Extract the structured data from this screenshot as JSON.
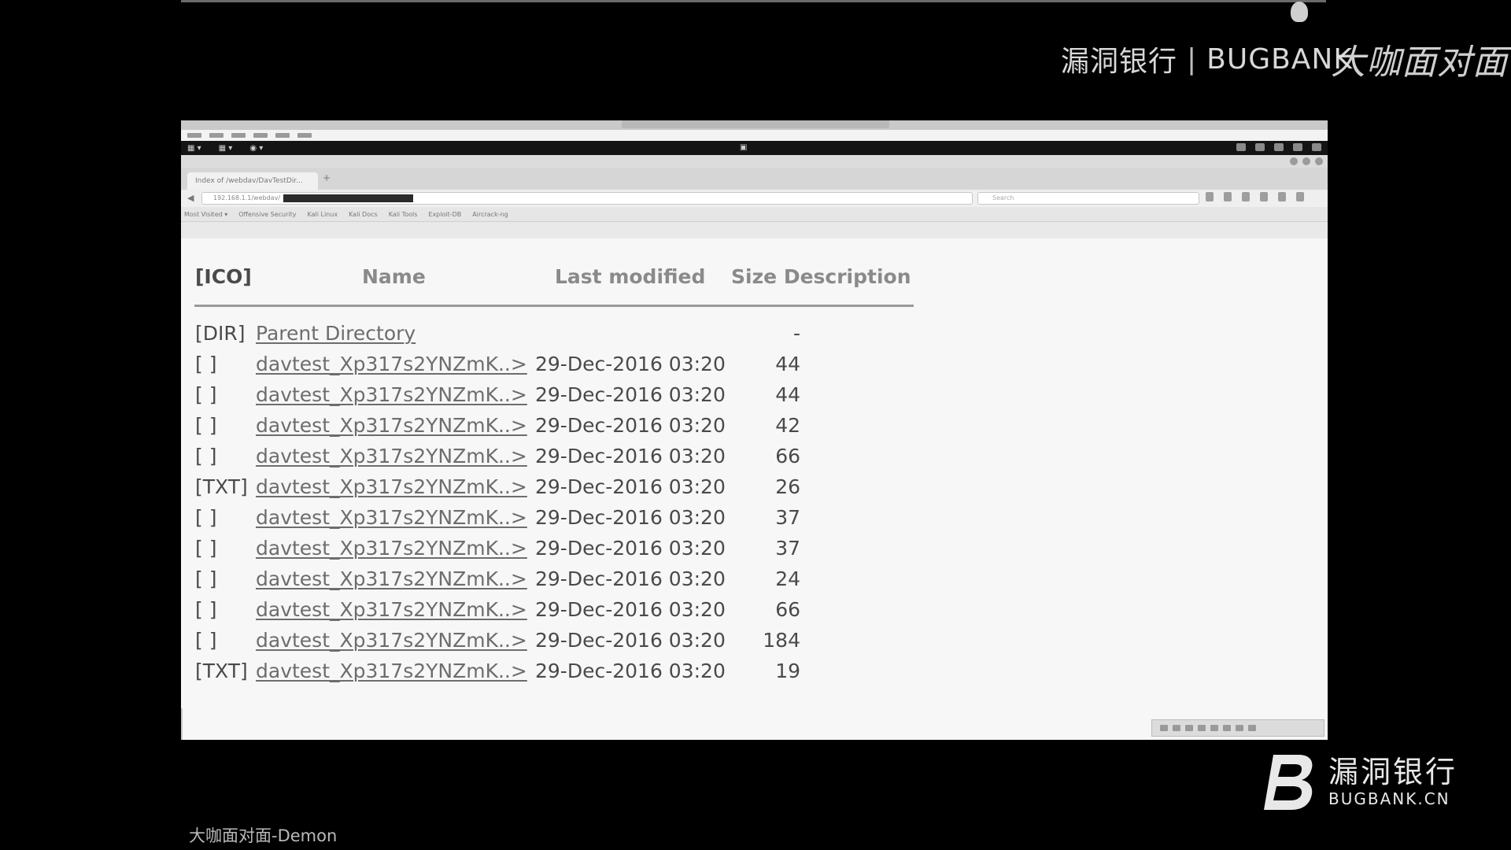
{
  "watermark_top": {
    "brand_cn": "漏洞银行",
    "separator": "|",
    "brand_en": "BUGBANK",
    "overlay_script": "大咖面对面"
  },
  "browser": {
    "tab_label": "Index of /webdav/DavTestDir...",
    "url_label": "192.168.1.1/webdav/",
    "search_placeholder": "Search",
    "bookmarks": [
      "Most Visited ▾",
      "Offensive Security",
      "Kali Linux",
      "Kali Docs",
      "Kali Tools",
      "Exploit-DB",
      "Aircrack-ng"
    ]
  },
  "listing": {
    "headers": {
      "icon": "[ICO]",
      "name": "Name",
      "modified": "Last modified",
      "size": "Size",
      "description": "Description"
    },
    "parent": {
      "icon": "[DIR]",
      "name": "Parent Directory",
      "size": "-"
    },
    "rows": [
      {
        "icon": "[ ]",
        "name": "davtest_Xp317s2YNZmK..>",
        "modified": "29-Dec-2016 03:20",
        "size": "44"
      },
      {
        "icon": "[ ]",
        "name": "davtest_Xp317s2YNZmK..>",
        "modified": "29-Dec-2016 03:20",
        "size": "44"
      },
      {
        "icon": "[ ]",
        "name": "davtest_Xp317s2YNZmK..>",
        "modified": "29-Dec-2016 03:20",
        "size": "42"
      },
      {
        "icon": "[ ]",
        "name": "davtest_Xp317s2YNZmK..>",
        "modified": "29-Dec-2016 03:20",
        "size": "66"
      },
      {
        "icon": "[TXT]",
        "name": "davtest_Xp317s2YNZmK..>",
        "modified": "29-Dec-2016 03:20",
        "size": "26"
      },
      {
        "icon": "[ ]",
        "name": "davtest_Xp317s2YNZmK..>",
        "modified": "29-Dec-2016 03:20",
        "size": "37"
      },
      {
        "icon": "[ ]",
        "name": "davtest_Xp317s2YNZmK..>",
        "modified": "29-Dec-2016 03:20",
        "size": "37"
      },
      {
        "icon": "[ ]",
        "name": "davtest_Xp317s2YNZmK..>",
        "modified": "29-Dec-2016 03:20",
        "size": "24"
      },
      {
        "icon": "[ ]",
        "name": "davtest_Xp317s2YNZmK..>",
        "modified": "29-Dec-2016 03:20",
        "size": "66"
      },
      {
        "icon": "[ ]",
        "name": "davtest_Xp317s2YNZmK..>",
        "modified": "29-Dec-2016 03:20",
        "size": "184"
      },
      {
        "icon": "[TXT]",
        "name": "davtest_Xp317s2YNZmK..>",
        "modified": "29-Dec-2016 03:20",
        "size": "19"
      }
    ]
  },
  "logo": {
    "cn": "漏洞银行",
    "en": "BUGBANK.CN"
  },
  "credit": "大咖面对面-Demon"
}
